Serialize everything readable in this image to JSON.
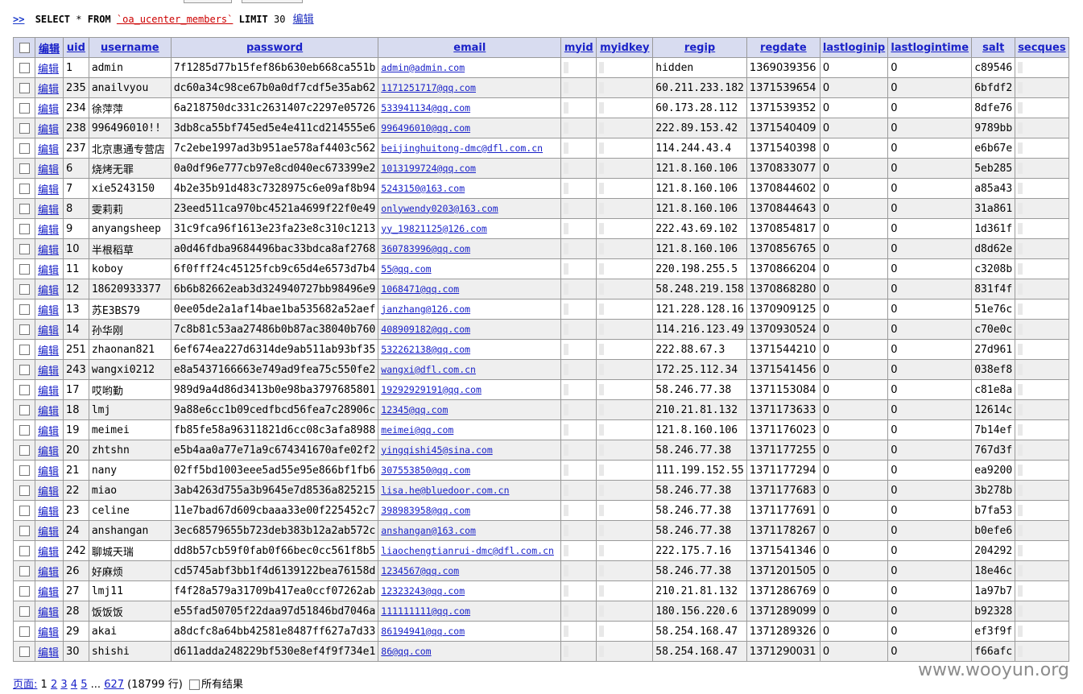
{
  "sql": {
    "prefix": ">>",
    "select": "SELECT",
    "star": "*",
    "from": "FROM",
    "table": "`oa_ucenter_members`",
    "limit": "LIMIT",
    "limit_value": "30",
    "edit_label": "编辑"
  },
  "table": {
    "headers": [
      "编辑",
      "uid",
      "username",
      "password",
      "email",
      "myid",
      "myidkey",
      "regip",
      "regdate",
      "lastloginip",
      "lastlogintime",
      "salt",
      "secques"
    ],
    "rows": [
      {
        "edit": "编辑",
        "uid": "1",
        "username": "admin",
        "password": "7f1285d77b15fef86b630eb668ca551b",
        "email": "admin@admin.com",
        "regip": "hidden",
        "regdate": "1369039356",
        "lastloginip": "0",
        "lastlogintime": "0",
        "salt": "c89546"
      },
      {
        "edit": "编辑",
        "uid": "235",
        "username": "anailvyou",
        "password": "dc60a34c98ce67b0a0df7cdf5e35ab62",
        "email": "1171251717@qq.com",
        "regip": "60.211.233.182",
        "regdate": "1371539654",
        "lastloginip": "0",
        "lastlogintime": "0",
        "salt": "6bfdf2"
      },
      {
        "edit": "编辑",
        "uid": "234",
        "username": "徐萍萍",
        "password": "6a218750dc331c2631407c2297e05726",
        "email": "533941134@qq.com",
        "regip": "60.173.28.112",
        "regdate": "1371539352",
        "lastloginip": "0",
        "lastlogintime": "0",
        "salt": "8dfe76"
      },
      {
        "edit": "编辑",
        "uid": "238",
        "username": "996496010!!",
        "password": "3db8ca55bf745ed5e4e411cd214555e6",
        "email": "996496010@qq.com",
        "regip": "222.89.153.42",
        "regdate": "1371540409",
        "lastloginip": "0",
        "lastlogintime": "0",
        "salt": "9789bb"
      },
      {
        "edit": "编辑",
        "uid": "237",
        "username": "北京惠通专营店",
        "password": "7c2ebe1997ad3b951ae578af4403c562",
        "email": "beijinghuitong-dmc@dfl.com.cn",
        "regip": "114.244.43.4",
        "regdate": "1371540398",
        "lastloginip": "0",
        "lastlogintime": "0",
        "salt": "e6b67e"
      },
      {
        "edit": "编辑",
        "uid": "6",
        "username": "烧烤无罪",
        "password": "0a0df96e777cb97e8cd040ec673399e2",
        "email": "1013199724@qq.com",
        "regip": "121.8.160.106",
        "regdate": "1370833077",
        "lastloginip": "0",
        "lastlogintime": "0",
        "salt": "5eb285"
      },
      {
        "edit": "编辑",
        "uid": "7",
        "username": "xie5243150",
        "password": "4b2e35b91d483c7328975c6e09af8b94",
        "email": "5243150@163.com",
        "regip": "121.8.160.106",
        "regdate": "1370844602",
        "lastloginip": "0",
        "lastlogintime": "0",
        "salt": "a85a43"
      },
      {
        "edit": "编辑",
        "uid": "8",
        "username": "雯莉莉",
        "password": "23eed511ca970bc4521a4699f22f0e49",
        "email": "onlywendy0203@163.com",
        "regip": "121.8.160.106",
        "regdate": "1370844643",
        "lastloginip": "0",
        "lastlogintime": "0",
        "salt": "31a861"
      },
      {
        "edit": "编辑",
        "uid": "9",
        "username": "anyangsheep",
        "password": "31c9fca96f1613e23fa23e8c310c1213",
        "email": "yy_19821125@126.com",
        "regip": "222.43.69.102",
        "regdate": "1370854817",
        "lastloginip": "0",
        "lastlogintime": "0",
        "salt": "1d361f"
      },
      {
        "edit": "编辑",
        "uid": "10",
        "username": "半根稻草",
        "password": "a0d46fdba9684496bac33bdca8af2768",
        "email": "360783996@qq.com",
        "regip": "121.8.160.106",
        "regdate": "1370856765",
        "lastloginip": "0",
        "lastlogintime": "0",
        "salt": "d8d62e"
      },
      {
        "edit": "编辑",
        "uid": "11",
        "username": "koboy",
        "password": "6f0fff24c45125fcb9c65d4e6573d7b4",
        "email": "55@qq.com",
        "regip": "220.198.255.5",
        "regdate": "1370866204",
        "lastloginip": "0",
        "lastlogintime": "0",
        "salt": "c3208b"
      },
      {
        "edit": "编辑",
        "uid": "12",
        "username": "18620933377",
        "password": "6b6b82662eab3d324940727bb98496e9",
        "email": "1068471@qq.com",
        "regip": "58.248.219.158",
        "regdate": "1370868280",
        "lastloginip": "0",
        "lastlogintime": "0",
        "salt": "831f4f"
      },
      {
        "edit": "编辑",
        "uid": "13",
        "username": "苏E3BS79",
        "password": "0ee05de2a1af14bae1ba535682a52aef",
        "email": "janzhang@126.com",
        "regip": "121.228.128.16",
        "regdate": "1370909125",
        "lastloginip": "0",
        "lastlogintime": "0",
        "salt": "51e76c"
      },
      {
        "edit": "编辑",
        "uid": "14",
        "username": "孙华刚",
        "password": "7c8b81c53aa27486b0b87ac38040b760",
        "email": "408909182@qq.com",
        "regip": "114.216.123.49",
        "regdate": "1370930524",
        "lastloginip": "0",
        "lastlogintime": "0",
        "salt": "c70e0c"
      },
      {
        "edit": "编辑",
        "uid": "251",
        "username": "zhaonan821",
        "password": "6ef674ea227d6314de9ab511ab93bf35",
        "email": "532262138@qq.com",
        "regip": "222.88.67.3",
        "regdate": "1371544210",
        "lastloginip": "0",
        "lastlogintime": "0",
        "salt": "27d961"
      },
      {
        "edit": "编辑",
        "uid": "243",
        "username": "wangxi0212",
        "password": "e8a5437166663e749ad9fea75c550fe2",
        "email": "wangxi@dfl.com.cn",
        "regip": "172.25.112.34",
        "regdate": "1371541456",
        "lastloginip": "0",
        "lastlogintime": "0",
        "salt": "038ef8"
      },
      {
        "edit": "编辑",
        "uid": "17",
        "username": "哎哟勤",
        "password": "989d9a4d86d3413b0e98ba3797685801",
        "email": "19292929191@qq.com",
        "regip": "58.246.77.38",
        "regdate": "1371153084",
        "lastloginip": "0",
        "lastlogintime": "0",
        "salt": "c81e8a"
      },
      {
        "edit": "编辑",
        "uid": "18",
        "username": "lmj",
        "password": "9a88e6cc1b09cedfbcd56fea7c28906c",
        "email": "12345@qq.com",
        "regip": "210.21.81.132",
        "regdate": "1371173633",
        "lastloginip": "0",
        "lastlogintime": "0",
        "salt": "12614c"
      },
      {
        "edit": "编辑",
        "uid": "19",
        "username": "meimei",
        "password": "fb85fe58a96311821d6cc08c3afa8988",
        "email": "meimei@qq.com",
        "regip": "121.8.160.106",
        "regdate": "1371176023",
        "lastloginip": "0",
        "lastlogintime": "0",
        "salt": "7b14ef"
      },
      {
        "edit": "编辑",
        "uid": "20",
        "username": "zhtshn",
        "password": "e5b4aa0a77e71a9c674341670afe02f2",
        "email": "yingqishi45@sina.com",
        "regip": "58.246.77.38",
        "regdate": "1371177255",
        "lastloginip": "0",
        "lastlogintime": "0",
        "salt": "767d3f"
      },
      {
        "edit": "编辑",
        "uid": "21",
        "username": "nany",
        "password": "02ff5bd1003eee5ad55e95e866bf1fb6",
        "email": "307553850@qq.com",
        "regip": "111.199.152.55",
        "regdate": "1371177294",
        "lastloginip": "0",
        "lastlogintime": "0",
        "salt": "ea9200"
      },
      {
        "edit": "编辑",
        "uid": "22",
        "username": "miao",
        "password": "3ab4263d755a3b9645e7d8536a825215",
        "email": "lisa.he@bluedoor.com.cn",
        "regip": "58.246.77.38",
        "regdate": "1371177683",
        "lastloginip": "0",
        "lastlogintime": "0",
        "salt": "3b278b"
      },
      {
        "edit": "编辑",
        "uid": "23",
        "username": "celine",
        "password": "11e7bad67d609cbaaa33e00f225452c7",
        "email": "398983958@qq.com",
        "regip": "58.246.77.38",
        "regdate": "1371177691",
        "lastloginip": "0",
        "lastlogintime": "0",
        "salt": "b7fa53"
      },
      {
        "edit": "编辑",
        "uid": "24",
        "username": "anshangan",
        "password": "3ec68579655b723deb383b12a2ab572c",
        "email": "anshangan@163.com",
        "regip": "58.246.77.38",
        "regdate": "1371178267",
        "lastloginip": "0",
        "lastlogintime": "0",
        "salt": "b0efe6"
      },
      {
        "edit": "编辑",
        "uid": "242",
        "username": "聊城天瑞",
        "password": "dd8b57cb59f0fab0f66bec0cc561f8b5",
        "email": "liaochengtianrui-dmc@dfl.com.cn",
        "regip": "222.175.7.16",
        "regdate": "1371541346",
        "lastloginip": "0",
        "lastlogintime": "0",
        "salt": "204292"
      },
      {
        "edit": "编辑",
        "uid": "26",
        "username": "好麻烦",
        "password": "cd5745abf3bb1f4d6139122bea76158d",
        "email": "1234567@qq.com",
        "regip": "58.246.77.38",
        "regdate": "1371201505",
        "lastloginip": "0",
        "lastlogintime": "0",
        "salt": "18e46c"
      },
      {
        "edit": "编辑",
        "uid": "27",
        "username": "lmj11",
        "password": "f4f28a579a31709b417ea0ccf07262ab",
        "email": "12323243@qq.com",
        "regip": "210.21.81.132",
        "regdate": "1371286769",
        "lastloginip": "0",
        "lastlogintime": "0",
        "salt": "1a97b7"
      },
      {
        "edit": "编辑",
        "uid": "28",
        "username": "饭饭饭",
        "password": "e55fad50705f22daa97d51846bd7046a",
        "email": "111111111@qq.com",
        "regip": "180.156.220.6",
        "regdate": "1371289099",
        "lastloginip": "0",
        "lastlogintime": "0",
        "salt": "b92328"
      },
      {
        "edit": "编辑",
        "uid": "29",
        "username": "akai",
        "password": "a8dcfc8a64bb42581e8487ff627a7d33",
        "email": "86194941@qq.com",
        "regip": "58.254.168.47",
        "regdate": "1371289326",
        "lastloginip": "0",
        "lastlogintime": "0",
        "salt": "ef3f9f"
      },
      {
        "edit": "编辑",
        "uid": "30",
        "username": "shishi",
        "password": "d611adda248229bf530e8ef4f9f734e1",
        "email": "86@qq.com",
        "regip": "58.254.168.47",
        "regdate": "1371290031",
        "lastloginip": "0",
        "lastlogintime": "0",
        "salt": "f66afc"
      }
    ]
  },
  "pager": {
    "label": "页面:",
    "current": "1",
    "pages": [
      "2",
      "3",
      "4",
      "5"
    ],
    "ellipsis": "...",
    "last": "627",
    "total": "(18799 行)",
    "all_results": "所有结果"
  },
  "watermark": "www.wooyun.org"
}
